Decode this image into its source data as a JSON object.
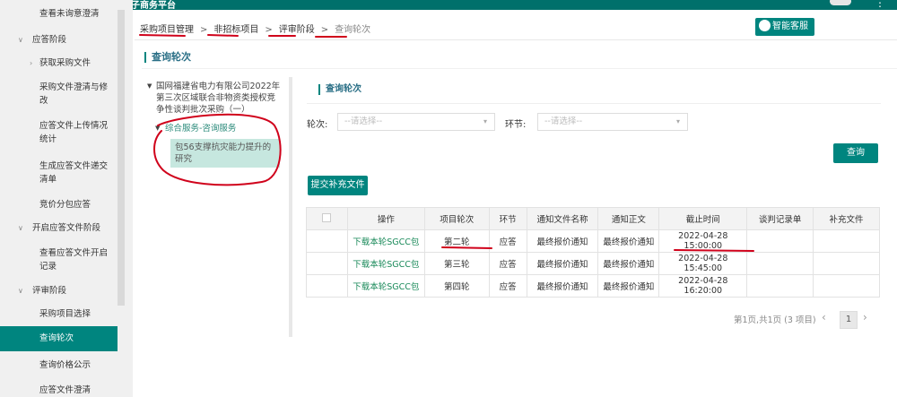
{
  "app": {
    "brand_text": "国家电网新一代电子商务平台"
  },
  "sidebar": {
    "items": [
      {
        "label": "查看未询意澄清",
        "kind": "sub"
      },
      {
        "label": "应答阶段",
        "kind": "group"
      },
      {
        "label": "获取采购文件",
        "kind": "sub-arrow"
      },
      {
        "label": "采购文件澄清与修改",
        "kind": "sub"
      },
      {
        "label": "应答文件上传情况统计",
        "kind": "sub"
      },
      {
        "label": "生成应答文件递交清单",
        "kind": "sub"
      },
      {
        "label": "竞价分包应答",
        "kind": "sub"
      },
      {
        "label": "开启应答文件阶段",
        "kind": "group"
      },
      {
        "label": "查看应答文件开启记录",
        "kind": "sub"
      },
      {
        "label": "评审阶段",
        "kind": "group"
      },
      {
        "label": "采购项目选择",
        "kind": "sub"
      },
      {
        "label": "查询轮次",
        "kind": "sub",
        "active": true
      },
      {
        "label": "查询价格公示",
        "kind": "sub"
      },
      {
        "label": "应答文件澄清",
        "kind": "sub"
      }
    ]
  },
  "breadcrumb": [
    "采购项目管理",
    "非招标项目",
    "评审阶段",
    "查询轮次"
  ],
  "service_button": "智能客服",
  "page_title": "查询轮次",
  "tree": {
    "root": "国网福建省电力有限公司2022年第三次区域联合非物资类授权竞争性谈判批次采购（一）",
    "child": "综合服务-咨询服务",
    "leaf": "包56支撑抗灾能力提升的研究"
  },
  "panel": {
    "title": "查询轮次",
    "round_label": "轮次:",
    "round_placeholder": "--请选择--",
    "stage_label": "环节:",
    "stage_placeholder": "--请选择--",
    "query_button": "查询",
    "submit_button": "提交补充文件"
  },
  "table": {
    "headers": [
      "操作",
      "项目轮次",
      "环节",
      "通知文件名称",
      "通知正文",
      "截止时间",
      "谈判记录单",
      "补充文件"
    ],
    "rows": [
      [
        "下载本轮SGCC包",
        "第二轮",
        "应答",
        "最终报价通知",
        "最终报价通知",
        "2022-04-28 15:00:00",
        "",
        ""
      ],
      [
        "下载本轮SGCC包",
        "第三轮",
        "应答",
        "最终报价通知",
        "最终报价通知",
        "2022-04-28 15:45:00",
        "",
        ""
      ],
      [
        "下载本轮SGCC包",
        "第四轮",
        "应答",
        "最终报价通知",
        "最终报价通知",
        "2022-04-28 16:20:00",
        "",
        ""
      ]
    ]
  },
  "pager": {
    "summary": "第1页,共1页 (3 项目)",
    "current_page": "1"
  },
  "colors": {
    "brand": "#00857f",
    "annotation": "#d0021b"
  }
}
